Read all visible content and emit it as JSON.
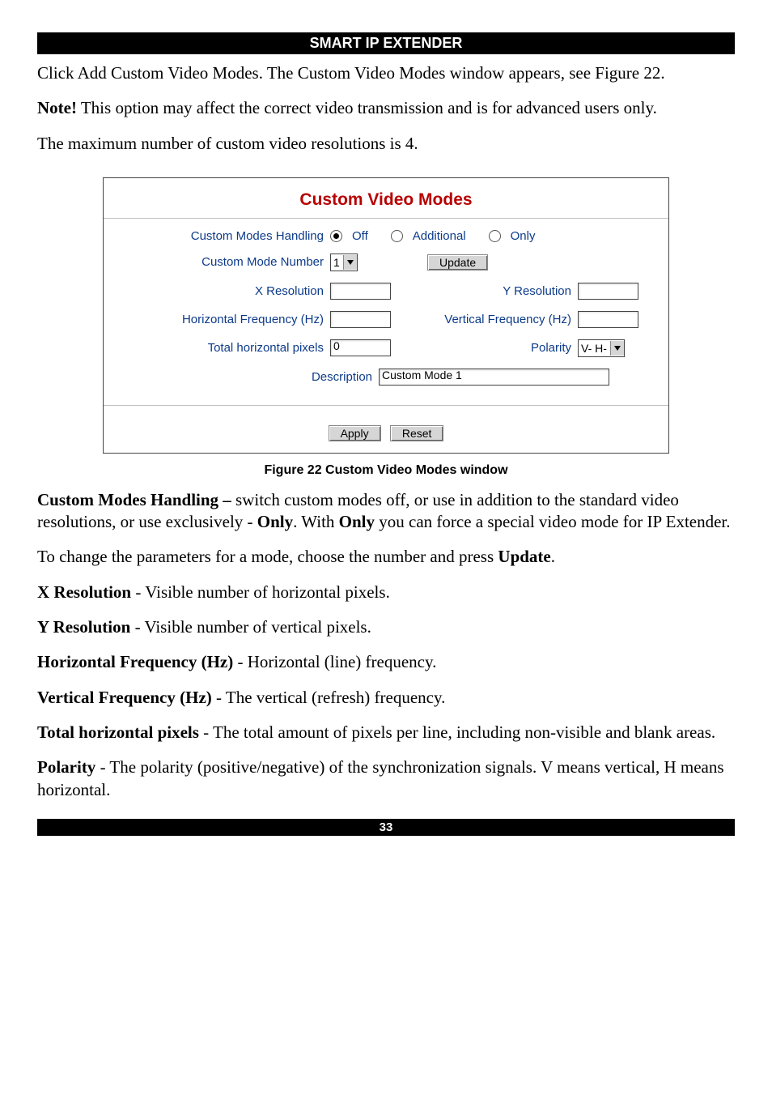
{
  "header": {
    "title": "SMART IP EXTENDER"
  },
  "intro": "Click Add Custom Video Modes. The Custom Video Modes window appears, see Figure 22.",
  "note_label": "Note!",
  "note_rest": " This option may affect the correct video transmission and is for advanced users only.",
  "max_line": "The maximum number of custom video resolutions is 4.",
  "figure": {
    "title": "Custom Video Modes",
    "caption": "Figure 22 Custom Video Modes window",
    "labels": {
      "custom_modes_handling": "Custom Modes Handling",
      "opt_off": "Off",
      "opt_additional": "Additional",
      "opt_only": "Only",
      "custom_mode_number": "Custom Mode Number",
      "update_btn": "Update",
      "x_res": "X Resolution",
      "y_res": "Y Resolution",
      "h_freq": "Horizontal Frequency (Hz)",
      "v_freq": "Vertical Frequency (Hz)",
      "total_hpix": "Total horizontal pixels",
      "polarity": "Polarity",
      "description": "Description",
      "apply": "Apply",
      "reset": "Reset"
    },
    "values": {
      "mode_number": "1",
      "x_res": "",
      "y_res": "",
      "h_freq": "",
      "v_freq": "",
      "total_hpix": "0",
      "polarity": "V- H-",
      "description": "Custom Mode 1"
    }
  },
  "explain": {
    "cmh_label": "Custom Modes Handling – ",
    "cmh_rest_a": "switch custom modes off, or use in addition to the standard video resolutions, or use exclusively - ",
    "only_b": "Only",
    "cmh_rest_b": ". With ",
    "cmh_rest_c": " you can force a special video mode for IP Extender.",
    "change_a": "To change the parameters for a mode, choose the number and press ",
    "update_b": "Update",
    "dot": ".",
    "xres_l": "X Resolution",
    "xres_r": " - Visible number of horizontal pixels.",
    "yres_l": "Y Resolution",
    "yres_r": " - Visible number of vertical pixels.",
    "hf_l": "Horizontal Frequency (Hz)",
    "hf_r": " - Horizontal (line) frequency.",
    "vf_l": "Vertical Frequency (Hz)",
    "vf_r": " - The vertical (refresh) frequency.",
    "thp_l": "Total horizontal pixels",
    "thp_r": " - The total amount of pixels per line, including non-visible and blank areas.",
    "pol_l": "Polarity",
    "pol_r": " - The polarity (positive/negative) of the synchronization signals. V means vertical, H means horizontal."
  },
  "footer": {
    "page_number": "33"
  }
}
